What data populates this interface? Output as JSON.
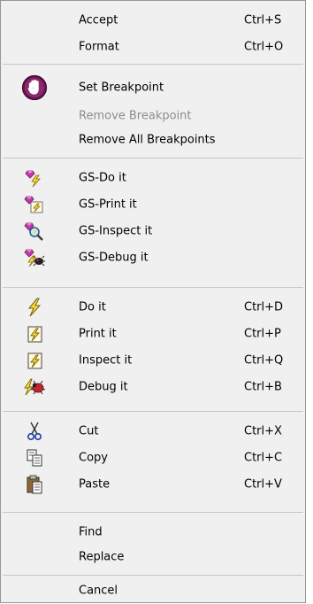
{
  "menu": {
    "accept": {
      "label": "Accept",
      "shortcut": "Ctrl+S"
    },
    "format": {
      "label": "Format",
      "shortcut": "Ctrl+O"
    },
    "set_breakpoint": {
      "label": "Set Breakpoint",
      "icon": "stop-hand-icon",
      "color": "#7a1f5c"
    },
    "remove_breakpoint": {
      "label": "Remove Breakpoint",
      "disabled": true
    },
    "remove_all_breakpoints": {
      "label": "Remove All Breakpoints"
    },
    "gs_do_it": {
      "label": "GS-Do it",
      "icon": "gem-lightning-icon"
    },
    "gs_print_it": {
      "label": "GS-Print it",
      "icon": "gem-print-icon"
    },
    "gs_inspect_it": {
      "label": "GS-Inspect it",
      "icon": "gem-inspect-icon"
    },
    "gs_debug_it": {
      "label": "GS-Debug it",
      "icon": "gem-debug-icon"
    },
    "do_it": {
      "label": "Do it",
      "shortcut": "Ctrl+D",
      "icon": "lightning-icon"
    },
    "print_it": {
      "label": "Print it",
      "shortcut": "Ctrl+P",
      "icon": "print-it-icon"
    },
    "inspect_it": {
      "label": "Inspect it",
      "shortcut": "Ctrl+Q",
      "icon": "inspect-it-icon"
    },
    "debug_it": {
      "label": "Debug it",
      "shortcut": "Ctrl+B",
      "icon": "bug-icon"
    },
    "cut": {
      "label": "Cut",
      "shortcut": "Ctrl+X",
      "icon": "scissors-icon"
    },
    "copy": {
      "label": "Copy",
      "shortcut": "Ctrl+C",
      "icon": "copy-icon"
    },
    "paste": {
      "label": "Paste",
      "shortcut": "Ctrl+V",
      "icon": "paste-icon"
    },
    "find": {
      "label": "Find"
    },
    "replace": {
      "label": "Replace"
    },
    "cancel": {
      "label": "Cancel"
    }
  },
  "colors": {
    "menu_bg": "#f0f0f0",
    "separator": "#c6c6c6",
    "disabled_text": "#8c8c8c",
    "accent_purple": "#7a1f5c"
  }
}
